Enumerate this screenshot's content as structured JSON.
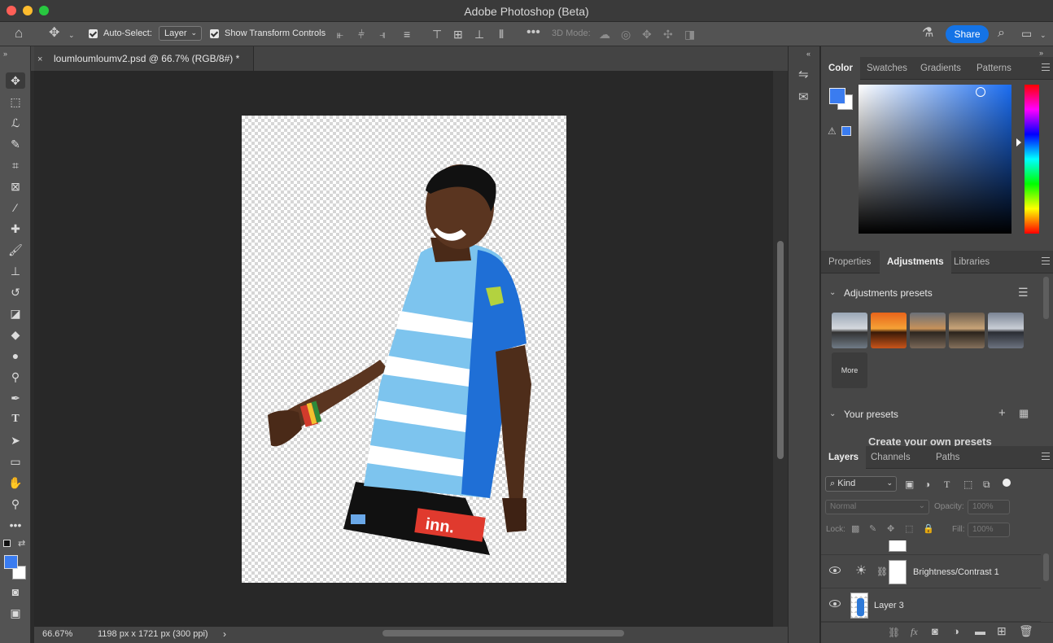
{
  "app": {
    "title": "Adobe Photoshop (Beta)"
  },
  "options_bar": {
    "auto_select_label": "Auto-Select:",
    "auto_select_value": "Layer",
    "show_transform_label": "Show Transform Controls",
    "mode_3d_label": "3D Mode:",
    "share_label": "Share"
  },
  "document": {
    "tab_title": "loumloumloumv2.psd @ 66.7% (RGB/8#) *",
    "zoom": "66.67%",
    "info": "1198 px x 1721 px (300 ppi)"
  },
  "color_panel": {
    "tabs": [
      "Color",
      "Swatches",
      "Gradients",
      "Patterns"
    ],
    "active_tab": "Color",
    "foreground": "#3a7cf0",
    "background": "#ffffff",
    "picker_hue": "#1a6cf0"
  },
  "adjustments_panel": {
    "tabs": [
      "Properties",
      "Adjustments",
      "Libraries"
    ],
    "active_tab": "Adjustments",
    "presets_header": "Adjustments presets",
    "more_label": "More",
    "your_presets_header": "Your presets",
    "create_presets_text": "Create your own presets"
  },
  "layers_panel": {
    "tabs": [
      "Layers",
      "Channels",
      "Paths"
    ],
    "active_tab": "Layers",
    "filter_kind": "Kind",
    "blend_mode": "Normal",
    "opacity_label": "Opacity:",
    "opacity_value": "100%",
    "lock_label": "Lock:",
    "fill_label": "Fill:",
    "fill_value": "100%",
    "layers": [
      {
        "name": "Brightness/Contrast 1",
        "visible": true,
        "type": "adjustment"
      },
      {
        "name": "Layer 3",
        "visible": true,
        "type": "pixel"
      }
    ]
  }
}
